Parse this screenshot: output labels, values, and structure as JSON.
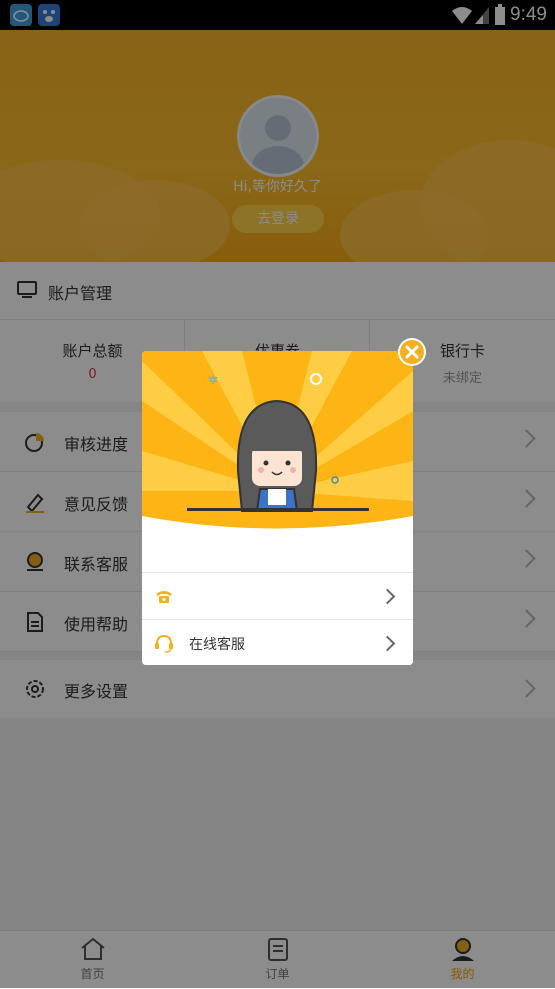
{
  "status_bar": {
    "time": "9:49",
    "app_icons": [
      "cloud-app-icon",
      "baidu-paw-icon"
    ]
  },
  "header": {
    "greeting": "Hi,等你好久了",
    "login_button": "去登录"
  },
  "account": {
    "title": "账户管理",
    "stats": [
      {
        "label": "账户总额",
        "value": "0",
        "value_color": "#e03a3a"
      },
      {
        "label": "优惠券",
        "value": ""
      },
      {
        "label": "银行卡",
        "value": "未绑定",
        "value_color": "#999999"
      }
    ]
  },
  "menu": {
    "items": [
      {
        "label": "审核进度",
        "icon": "pie-chart-icon"
      },
      {
        "label": "意见反馈",
        "icon": "pencil-icon"
      },
      {
        "label": "联系客服",
        "icon": "service-agent-icon"
      },
      {
        "label": "使用帮助",
        "icon": "document-icon"
      }
    ],
    "settings": {
      "label": "更多设置",
      "icon": "gear-icon"
    }
  },
  "tabbar": {
    "tabs": [
      {
        "label": "首页",
        "icon": "home-icon"
      },
      {
        "label": "订单",
        "icon": "clipboard-icon"
      },
      {
        "label": "我的",
        "icon": "user-icon",
        "active": true
      }
    ]
  },
  "dialog": {
    "rows": [
      {
        "label": "",
        "icon": "phone-icon"
      },
      {
        "label": "在线客服",
        "icon": "headset-icon"
      }
    ]
  },
  "colors": {
    "accent": "#f9b42a",
    "active_tab": "#f0a800"
  }
}
